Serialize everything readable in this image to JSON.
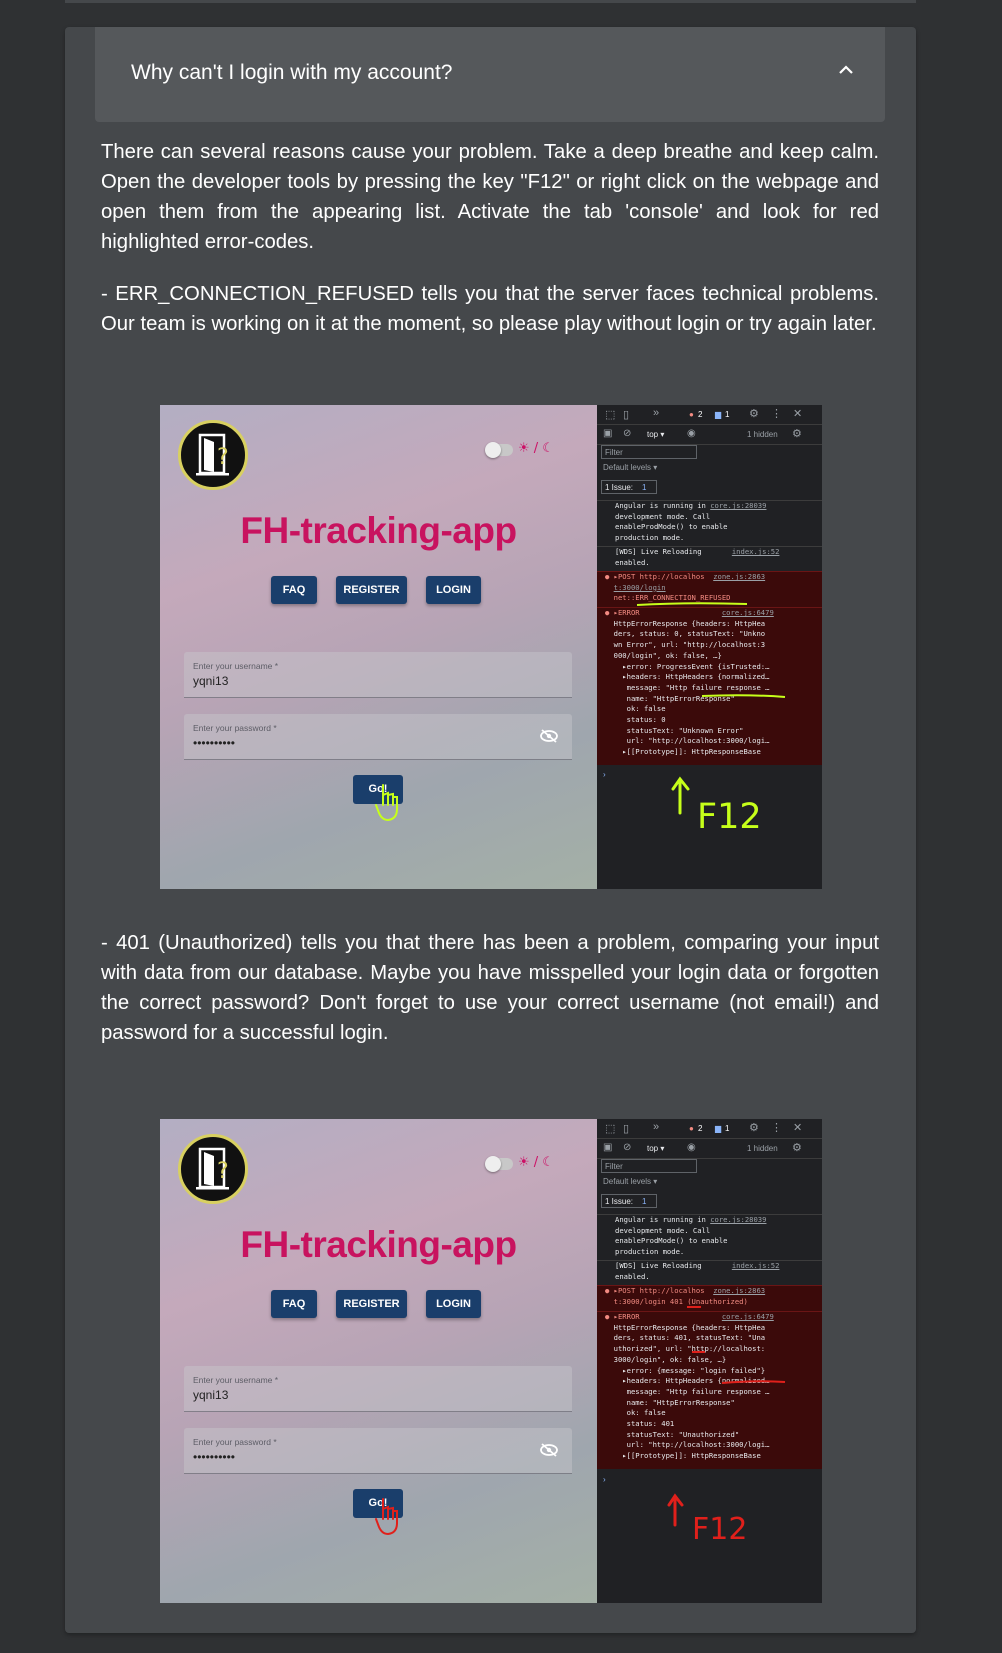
{
  "faq": {
    "question": "Why can't I login with my account?",
    "intro": "There can several reasons cause your problem. Take a deep breathe and keep calm. Open the developer tools by pressing the key \"F12\" or right click on the webpage and open them from the appearing list. Activate the tab 'console' and look for red highlighted error-codes.",
    "item1": "- ERR_CONNECTION_REFUSED tells you that the server faces technical problems. Our team is working on it at the moment, so please play without login or try again later.",
    "item2": "- 401 (Unauthorized) tells you that there has been a problem, comparing your input with data from our database. Maybe you have misspelled your login data or forgotten the correct password? Don't forget to use your correct username (not email!) and password for a successful login."
  },
  "app": {
    "title": "FH-tracking-app",
    "mode_icons": "☀ / ☾",
    "nav": [
      "FAQ",
      "REGISTER",
      "LOGIN"
    ],
    "username_label": "Enter your username *",
    "username_value": "yqni13",
    "password_label": "Enter your password *",
    "password_value": "••••••••••",
    "go_label": "Go!"
  },
  "devtools": {
    "errors_count": "2",
    "messages_count": "1",
    "context": "top ▾",
    "hidden": "1 hidden",
    "filter_placeholder": "Filter",
    "levels": "Default levels ▾",
    "issues": "1 Issue:",
    "issues_count": "1",
    "angular_lines": [
      "Angular is running in ",
      "development mode. Call",
      "enableProdMode() to enable",
      "production mode."
    ],
    "angular_link": "core.js:28039",
    "wds_lines": [
      "[WDS] Live Reloading ",
      "enabled."
    ],
    "wds_link": "index.js:52",
    "post_link": "zone.js:2863",
    "error_link": "core.js:6479"
  },
  "shot1": {
    "post_lines": [
      "▸POST http://localhos",
      "t:3000/login",
      "net::ERR_CONNECTION_REFUSED"
    ],
    "error_lines": [
      "▸ERROR",
      "HttpErrorResponse {headers: HttpHea",
      "ders, status: 0, statusText: \"Unkno",
      "wn Error\", url: \"http://localhost:3",
      "000/login\", ok: false, …}",
      "  ▸error: ProgressEvent {isTrusted:…",
      "  ▸headers: HttpHeaders {normalized…",
      "   message: \"Http failure response …",
      "   name: \"HttpErrorResponse\"",
      "   ok: false",
      "   status: 0",
      "   statusText: \"Unknown Error\"",
      "   url: \"http://localhost:3000/logi…",
      "  ▸[[Prototype]]: HttpResponseBase"
    ],
    "annotation": "F12"
  },
  "shot2": {
    "post_lines": [
      "▸POST http://localhos",
      "t:3000/login 401 (Unauthorized)"
    ],
    "error_lines": [
      "▸ERROR",
      "HttpErrorResponse {headers: HttpHea",
      "ders, status: 401, statusText: \"Una",
      "uthorized\", url: \"http://localhost:",
      "3000/login\", ok: false, …}",
      "  ▸error: {message: \"login failed\"}",
      "  ▸headers: HttpHeaders {normalized…",
      "   message: \"Http failure response …",
      "   name: \"HttpErrorResponse\"",
      "   ok: false",
      "   status: 401",
      "   statusText: \"Unauthorized\"",
      "   url: \"http://localhost:3000/logi…",
      "  ▸[[Prototype]]: HttpResponseBase"
    ],
    "annotation": "F12"
  },
  "colors": {
    "page_bg": "#2f3133",
    "card_bg": "#45484b",
    "header_bg": "#55585b",
    "brand_pink": "#c8135f",
    "button_blue": "#1a3e6b",
    "annotation_green": "#c6ff1a",
    "annotation_red": "#e0201b"
  }
}
